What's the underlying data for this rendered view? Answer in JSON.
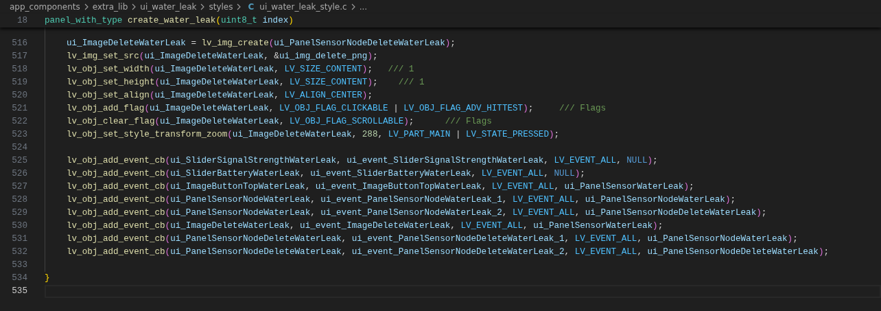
{
  "breadcrumbs": [
    {
      "kind": "folder",
      "label": "app_components"
    },
    {
      "kind": "folder",
      "label": "extra_lib"
    },
    {
      "kind": "folder",
      "label": "ui_water_leak"
    },
    {
      "kind": "folder",
      "label": "styles"
    },
    {
      "kind": "c_file",
      "label": "ui_water_leak_style.c",
      "icon_text": "C"
    },
    {
      "kind": "more",
      "label": "..."
    }
  ],
  "sticky_line": {
    "number": "18",
    "tokens": [
      {
        "kind": "type",
        "text": "panel_with_type"
      },
      {
        "kind": "space"
      },
      {
        "kind": "fn",
        "text": "create_water_leak"
      },
      {
        "kind": "b1",
        "text": "("
      },
      {
        "kind": "type",
        "text": "uint8_t"
      },
      {
        "kind": "space"
      },
      {
        "kind": "var",
        "text": "index"
      },
      {
        "kind": "b1",
        "text": ")"
      }
    ]
  },
  "lines": [
    {
      "number": "516",
      "indented": true,
      "current": false,
      "tokens": [
        {
          "kind": "var",
          "text": "ui_ImageDeleteWaterLeak"
        },
        {
          "kind": "plain",
          "text": " = "
        },
        {
          "kind": "fn",
          "text": "lv_img_create"
        },
        {
          "kind": "b2",
          "text": "("
        },
        {
          "kind": "var",
          "text": "ui_PanelSensorNodeDeleteWaterLeak"
        },
        {
          "kind": "b2",
          "text": ")"
        },
        {
          "kind": "plain",
          "text": ";"
        }
      ]
    },
    {
      "number": "517",
      "indented": true,
      "current": false,
      "tokens": [
        {
          "kind": "fn",
          "text": "lv_img_set_src"
        },
        {
          "kind": "b2",
          "text": "("
        },
        {
          "kind": "var",
          "text": "ui_ImageDeleteWaterLeak"
        },
        {
          "kind": "plain",
          "text": ", &"
        },
        {
          "kind": "var",
          "text": "ui_img_delete_png"
        },
        {
          "kind": "b2",
          "text": ")"
        },
        {
          "kind": "plain",
          "text": ";"
        }
      ]
    },
    {
      "number": "518",
      "indented": true,
      "current": false,
      "tokens": [
        {
          "kind": "fn",
          "text": "lv_obj_set_width"
        },
        {
          "kind": "b2",
          "text": "("
        },
        {
          "kind": "var",
          "text": "ui_ImageDeleteWaterLeak"
        },
        {
          "kind": "plain",
          "text": ", "
        },
        {
          "kind": "const",
          "text": "LV_SIZE_CONTENT"
        },
        {
          "kind": "b2",
          "text": ")"
        },
        {
          "kind": "plain",
          "text": ";   "
        },
        {
          "kind": "comment",
          "text": "/// 1"
        }
      ]
    },
    {
      "number": "519",
      "indented": true,
      "current": false,
      "tokens": [
        {
          "kind": "fn",
          "text": "lv_obj_set_height"
        },
        {
          "kind": "b2",
          "text": "("
        },
        {
          "kind": "var",
          "text": "ui_ImageDeleteWaterLeak"
        },
        {
          "kind": "plain",
          "text": ", "
        },
        {
          "kind": "const",
          "text": "LV_SIZE_CONTENT"
        },
        {
          "kind": "b2",
          "text": ")"
        },
        {
          "kind": "plain",
          "text": ";    "
        },
        {
          "kind": "comment",
          "text": "/// 1"
        }
      ]
    },
    {
      "number": "520",
      "indented": true,
      "current": false,
      "tokens": [
        {
          "kind": "fn",
          "text": "lv_obj_set_align"
        },
        {
          "kind": "b2",
          "text": "("
        },
        {
          "kind": "var",
          "text": "ui_ImageDeleteWaterLeak"
        },
        {
          "kind": "plain",
          "text": ", "
        },
        {
          "kind": "const",
          "text": "LV_ALIGN_CENTER"
        },
        {
          "kind": "b2",
          "text": ")"
        },
        {
          "kind": "plain",
          "text": ";"
        }
      ]
    },
    {
      "number": "521",
      "indented": true,
      "current": false,
      "tokens": [
        {
          "kind": "fn",
          "text": "lv_obj_add_flag"
        },
        {
          "kind": "b2",
          "text": "("
        },
        {
          "kind": "var",
          "text": "ui_ImageDeleteWaterLeak"
        },
        {
          "kind": "plain",
          "text": ", "
        },
        {
          "kind": "const",
          "text": "LV_OBJ_FLAG_CLICKABLE"
        },
        {
          "kind": "plain",
          "text": " | "
        },
        {
          "kind": "const",
          "text": "LV_OBJ_FLAG_ADV_HITTEST"
        },
        {
          "kind": "b2",
          "text": ")"
        },
        {
          "kind": "plain",
          "text": ";     "
        },
        {
          "kind": "comment",
          "text": "/// Flags"
        }
      ]
    },
    {
      "number": "522",
      "indented": true,
      "current": false,
      "tokens": [
        {
          "kind": "fn",
          "text": "lv_obj_clear_flag"
        },
        {
          "kind": "b2",
          "text": "("
        },
        {
          "kind": "var",
          "text": "ui_ImageDeleteWaterLeak"
        },
        {
          "kind": "plain",
          "text": ", "
        },
        {
          "kind": "const",
          "text": "LV_OBJ_FLAG_SCROLLABLE"
        },
        {
          "kind": "b2",
          "text": ")"
        },
        {
          "kind": "plain",
          "text": ";      "
        },
        {
          "kind": "comment",
          "text": "/// Flags"
        }
      ]
    },
    {
      "number": "523",
      "indented": true,
      "current": false,
      "tokens": [
        {
          "kind": "fn",
          "text": "lv_obj_set_style_transform_zoom"
        },
        {
          "kind": "b2",
          "text": "("
        },
        {
          "kind": "var",
          "text": "ui_ImageDeleteWaterLeak"
        },
        {
          "kind": "plain",
          "text": ", "
        },
        {
          "kind": "number",
          "text": "288"
        },
        {
          "kind": "plain",
          "text": ", "
        },
        {
          "kind": "const",
          "text": "LV_PART_MAIN"
        },
        {
          "kind": "plain",
          "text": " | "
        },
        {
          "kind": "const",
          "text": "LV_STATE_PRESSED"
        },
        {
          "kind": "b2",
          "text": ")"
        },
        {
          "kind": "plain",
          "text": ";"
        }
      ]
    },
    {
      "number": "524",
      "current": false
    },
    {
      "number": "525",
      "indented": true,
      "current": false,
      "tokens": [
        {
          "kind": "fn",
          "text": "lv_obj_add_event_cb"
        },
        {
          "kind": "b2",
          "text": "("
        },
        {
          "kind": "var",
          "text": "ui_SliderSignalStrengthWaterLeak"
        },
        {
          "kind": "plain",
          "text": ", "
        },
        {
          "kind": "var",
          "text": "ui_event_SliderSignalStrengthWaterLeak"
        },
        {
          "kind": "plain",
          "text": ", "
        },
        {
          "kind": "const",
          "text": "LV_EVENT_ALL"
        },
        {
          "kind": "plain",
          "text": ", "
        },
        {
          "kind": "keyword",
          "text": "NULL"
        },
        {
          "kind": "b2",
          "text": ")"
        },
        {
          "kind": "plain",
          "text": ";"
        }
      ]
    },
    {
      "number": "526",
      "indented": true,
      "current": false,
      "tokens": [
        {
          "kind": "fn",
          "text": "lv_obj_add_event_cb"
        },
        {
          "kind": "b2",
          "text": "("
        },
        {
          "kind": "var",
          "text": "ui_SliderBatteryWaterLeak"
        },
        {
          "kind": "plain",
          "text": ", "
        },
        {
          "kind": "var",
          "text": "ui_event_SliderBatteryWaterLeak"
        },
        {
          "kind": "plain",
          "text": ", "
        },
        {
          "kind": "const",
          "text": "LV_EVENT_ALL"
        },
        {
          "kind": "plain",
          "text": ", "
        },
        {
          "kind": "keyword",
          "text": "NULL"
        },
        {
          "kind": "b2",
          "text": ")"
        },
        {
          "kind": "plain",
          "text": ";"
        }
      ]
    },
    {
      "number": "527",
      "indented": true,
      "current": false,
      "tokens": [
        {
          "kind": "fn",
          "text": "lv_obj_add_event_cb"
        },
        {
          "kind": "b2",
          "text": "("
        },
        {
          "kind": "var",
          "text": "ui_ImageButtonTopWaterLeak"
        },
        {
          "kind": "plain",
          "text": ", "
        },
        {
          "kind": "var",
          "text": "ui_event_ImageButtonTopWaterLeak"
        },
        {
          "kind": "plain",
          "text": ", "
        },
        {
          "kind": "const",
          "text": "LV_EVENT_ALL"
        },
        {
          "kind": "plain",
          "text": ", "
        },
        {
          "kind": "var",
          "text": "ui_PanelSensorWaterLeak"
        },
        {
          "kind": "b2",
          "text": ")"
        },
        {
          "kind": "plain",
          "text": ";"
        }
      ]
    },
    {
      "number": "528",
      "indented": true,
      "current": false,
      "tokens": [
        {
          "kind": "fn",
          "text": "lv_obj_add_event_cb"
        },
        {
          "kind": "b2",
          "text": "("
        },
        {
          "kind": "var",
          "text": "ui_PanelSensorNodeWaterLeak"
        },
        {
          "kind": "plain",
          "text": ", "
        },
        {
          "kind": "var",
          "text": "ui_event_PanelSensorNodeWaterLeak_1"
        },
        {
          "kind": "plain",
          "text": ", "
        },
        {
          "kind": "const",
          "text": "LV_EVENT_ALL"
        },
        {
          "kind": "plain",
          "text": ", "
        },
        {
          "kind": "var",
          "text": "ui_PanelSensorNodeWaterLeak"
        },
        {
          "kind": "b2",
          "text": ")"
        },
        {
          "kind": "plain",
          "text": ";"
        }
      ]
    },
    {
      "number": "529",
      "indented": true,
      "current": false,
      "tokens": [
        {
          "kind": "fn",
          "text": "lv_obj_add_event_cb"
        },
        {
          "kind": "b2",
          "text": "("
        },
        {
          "kind": "var",
          "text": "ui_PanelSensorNodeWaterLeak"
        },
        {
          "kind": "plain",
          "text": ", "
        },
        {
          "kind": "var",
          "text": "ui_event_PanelSensorNodeWaterLeak_2"
        },
        {
          "kind": "plain",
          "text": ", "
        },
        {
          "kind": "const",
          "text": "LV_EVENT_ALL"
        },
        {
          "kind": "plain",
          "text": ", "
        },
        {
          "kind": "var",
          "text": "ui_PanelSensorNodeDeleteWaterLeak"
        },
        {
          "kind": "b2",
          "text": ")"
        },
        {
          "kind": "plain",
          "text": ";"
        }
      ]
    },
    {
      "number": "530",
      "indented": true,
      "current": false,
      "tokens": [
        {
          "kind": "fn",
          "text": "lv_obj_add_event_cb"
        },
        {
          "kind": "b2",
          "text": "("
        },
        {
          "kind": "var",
          "text": "ui_ImageDeleteWaterLeak"
        },
        {
          "kind": "plain",
          "text": ", "
        },
        {
          "kind": "var",
          "text": "ui_event_ImageDeleteWaterLeak"
        },
        {
          "kind": "plain",
          "text": ", "
        },
        {
          "kind": "const",
          "text": "LV_EVENT_ALL"
        },
        {
          "kind": "plain",
          "text": ", "
        },
        {
          "kind": "var",
          "text": "ui_PanelSensorWaterLeak"
        },
        {
          "kind": "b2",
          "text": ")"
        },
        {
          "kind": "plain",
          "text": ";"
        }
      ]
    },
    {
      "number": "531",
      "indented": true,
      "current": false,
      "tokens": [
        {
          "kind": "fn",
          "text": "lv_obj_add_event_cb"
        },
        {
          "kind": "b2",
          "text": "("
        },
        {
          "kind": "var",
          "text": "ui_PanelSensorNodeDeleteWaterLeak"
        },
        {
          "kind": "plain",
          "text": ", "
        },
        {
          "kind": "var",
          "text": "ui_event_PanelSensorNodeDeleteWaterLeak_1"
        },
        {
          "kind": "plain",
          "text": ", "
        },
        {
          "kind": "const",
          "text": "LV_EVENT_ALL"
        },
        {
          "kind": "plain",
          "text": ", "
        },
        {
          "kind": "var",
          "text": "ui_PanelSensorNodeWaterLeak"
        },
        {
          "kind": "b2",
          "text": ")"
        },
        {
          "kind": "plain",
          "text": ";"
        }
      ]
    },
    {
      "number": "532",
      "indented": true,
      "current": false,
      "tokens": [
        {
          "kind": "fn",
          "text": "lv_obj_add_event_cb"
        },
        {
          "kind": "b2",
          "text": "("
        },
        {
          "kind": "var",
          "text": "ui_PanelSensorNodeDeleteWaterLeak"
        },
        {
          "kind": "plain",
          "text": ", "
        },
        {
          "kind": "var",
          "text": "ui_event_PanelSensorNodeDeleteWaterLeak_2"
        },
        {
          "kind": "plain",
          "text": ", "
        },
        {
          "kind": "const",
          "text": "LV_EVENT_ALL"
        },
        {
          "kind": "plain",
          "text": ", "
        },
        {
          "kind": "var",
          "text": "ui_PanelSensorNodeDeleteWaterLeak"
        },
        {
          "kind": "b2",
          "text": ")"
        },
        {
          "kind": "plain",
          "text": ";"
        }
      ]
    },
    {
      "number": "533",
      "current": false
    },
    {
      "number": "534",
      "indented": false,
      "current": false,
      "tokens": [
        {
          "kind": "b1",
          "text": "}"
        }
      ]
    },
    {
      "number": "535",
      "current": true
    }
  ]
}
